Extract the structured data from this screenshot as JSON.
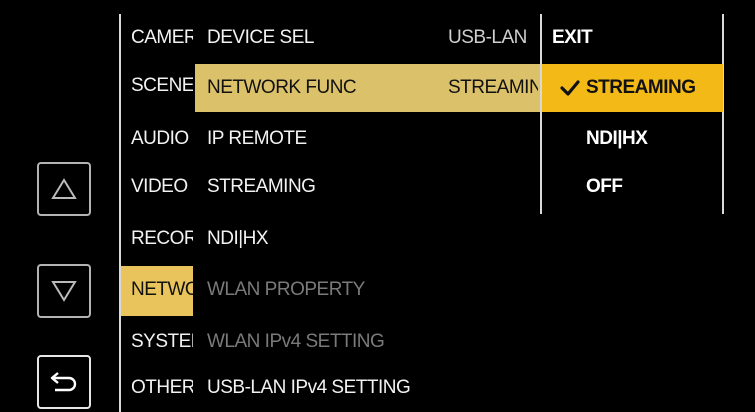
{
  "nav": {
    "up_icon": "triangle-up-icon",
    "down_icon": "triangle-down-icon",
    "back_icon": "return-arrow-icon"
  },
  "categories": [
    {
      "label": "CAMERA",
      "selected": false
    },
    {
      "label": "SCENE",
      "selected": false
    },
    {
      "label": "AUDIO",
      "selected": false
    },
    {
      "label": "VIDEO OUT",
      "selected": false
    },
    {
      "label": "RECORDING",
      "selected": false
    },
    {
      "label": "NETWORK",
      "selected": true
    },
    {
      "label": "SYSTEM",
      "selected": false
    },
    {
      "label": "OTHERS",
      "selected": false
    }
  ],
  "items": [
    {
      "label": "DEVICE SEL",
      "value": "USB-LAN",
      "state": "normal"
    },
    {
      "label": "NETWORK FUNC",
      "value": "STREAMING",
      "state": "selected"
    },
    {
      "label": "IP REMOTE",
      "value": "",
      "state": "normal"
    },
    {
      "label": "STREAMING",
      "value": "",
      "state": "normal"
    },
    {
      "label": "NDI|HX",
      "value": "",
      "state": "normal"
    },
    {
      "label": "WLAN PROPERTY",
      "value": "",
      "state": "dim"
    },
    {
      "label": "WLAN IPv4 SETTING",
      "value": "",
      "state": "dim"
    },
    {
      "label": "USB-LAN IPv4 SETTING",
      "value": "",
      "state": "normal"
    }
  ],
  "options": [
    {
      "label": "EXIT",
      "selected": false
    },
    {
      "label": "STREAMING",
      "selected": true
    },
    {
      "label": "NDI|HX",
      "selected": false
    },
    {
      "label": "OFF",
      "selected": false
    }
  ],
  "colors": {
    "category_highlight": "#e9c45c",
    "item_highlight": "#dcc16b",
    "option_highlight": "#f3ba17"
  }
}
